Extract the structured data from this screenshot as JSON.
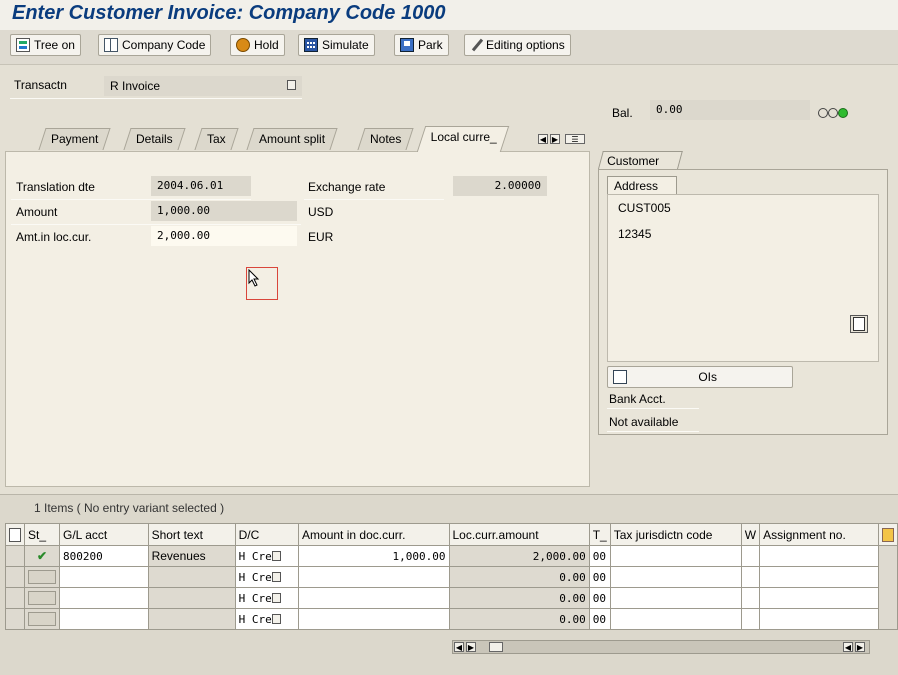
{
  "window": {
    "title": "Enter Customer Invoice: Company Code 1000"
  },
  "toolbar": {
    "tree_on": "Tree on",
    "company_code": "Company Code",
    "hold": "Hold",
    "simulate": "Simulate",
    "park": "Park",
    "editing_options": "Editing options"
  },
  "header": {
    "transaction_label": "Transactn",
    "transaction_value": "R Invoice",
    "balance_label": "Bal.",
    "balance_value": "0.00",
    "status_icon": "traffic-light-icon"
  },
  "tabs": [
    "Payment",
    "Details",
    "Tax",
    "Amount split",
    "Notes",
    "Local curre_"
  ],
  "local_currency": {
    "translation_date_label": "Translation dte",
    "translation_date": "2004.06.01",
    "exchange_rate_label": "Exchange rate",
    "exchange_rate": "2.00000",
    "amount_label": "Amount",
    "amount": "1,000.00",
    "amount_currency": "USD",
    "amt_loc_label": "Amt.in loc.cur.",
    "amt_loc": "2,000.00",
    "amt_loc_currency": "EUR"
  },
  "customer": {
    "tab_label": "Customer",
    "address_label": "Address",
    "id": "CUST005",
    "postal": "12345",
    "ois_button": "OIs",
    "bank_label": "Bank Acct.",
    "bank_value": "Not available"
  },
  "items": {
    "caption": "1 Items ( No entry variant selected )",
    "columns": [
      "St_",
      "G/L acct",
      "Short text",
      "D/C",
      "Amount in doc.curr.",
      "Loc.curr.amount",
      "T_",
      "Tax jurisdictn code",
      "W",
      "Assignment no."
    ],
    "rows": [
      {
        "status": "✔",
        "gl": "800200",
        "short_text": "Revenues",
        "dc": "H Cre",
        "amount_doc": "1,000.00",
        "amount_loc": "2,000.00",
        "tax": "00"
      },
      {
        "status": "",
        "gl": "",
        "short_text": "",
        "dc": "H Cre",
        "amount_doc": "",
        "amount_loc": "0.00",
        "tax": "00"
      },
      {
        "status": "",
        "gl": "",
        "short_text": "",
        "dc": "H Cre",
        "amount_doc": "",
        "amount_loc": "0.00",
        "tax": "00"
      },
      {
        "status": "",
        "gl": "",
        "short_text": "",
        "dc": "H Cre",
        "amount_doc": "",
        "amount_loc": "0.00",
        "tax": "00"
      }
    ]
  },
  "colors": {
    "title": "#0a3c7e",
    "panel": "#f3efe4",
    "background": "#e4e0d4"
  }
}
